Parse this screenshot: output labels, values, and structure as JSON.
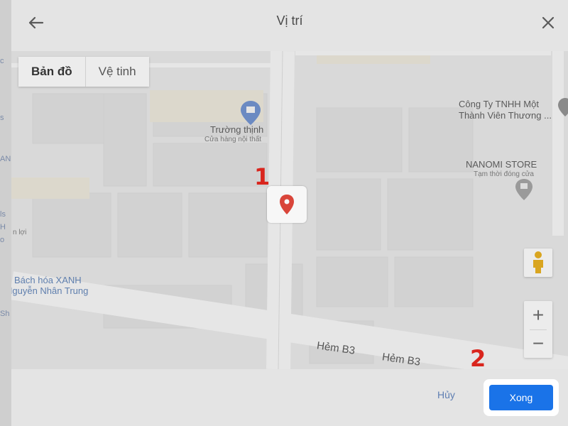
{
  "dialog": {
    "title": "Vị trí",
    "back_icon": "arrow-left-icon",
    "close_icon": "close-icon"
  },
  "map_type": {
    "map_label": "Bản đồ",
    "satellite_label": "Vệ tinh"
  },
  "places": {
    "truong_thinh_name": "Trường thịnh",
    "truong_thinh_sub": "Cửa hàng nội thất",
    "company_line1": "Công Ty TNHH Một",
    "company_line2": "Thành Viên Thương ...",
    "nanomi_name": "NANOMI STORE",
    "nanomi_sub": "Tạm thời đóng cửa",
    "bach_hoa_line1": "Bách hóa XANH",
    "bach_hoa_line2": "Nguyễn Nhân Trung",
    "left_fragment": "n lợi"
  },
  "streets": {
    "hem_b3_a": "Hẻm B3",
    "hem_b3_b": "Hẻm B3"
  },
  "annotations": {
    "step1": "1",
    "step2": "2"
  },
  "zoom": {
    "in_label": "+",
    "out_label": "−"
  },
  "footer": {
    "cancel_label": "Hủy",
    "done_label": "Xong"
  },
  "colors": {
    "accent": "#1a73e8",
    "pin": "#d9453a",
    "annotation": "#d9251d"
  },
  "backdrop": {
    "left_texts": [
      "c",
      "s",
      "AN",
      "ls",
      "H",
      "o",
      "Sh"
    ]
  }
}
